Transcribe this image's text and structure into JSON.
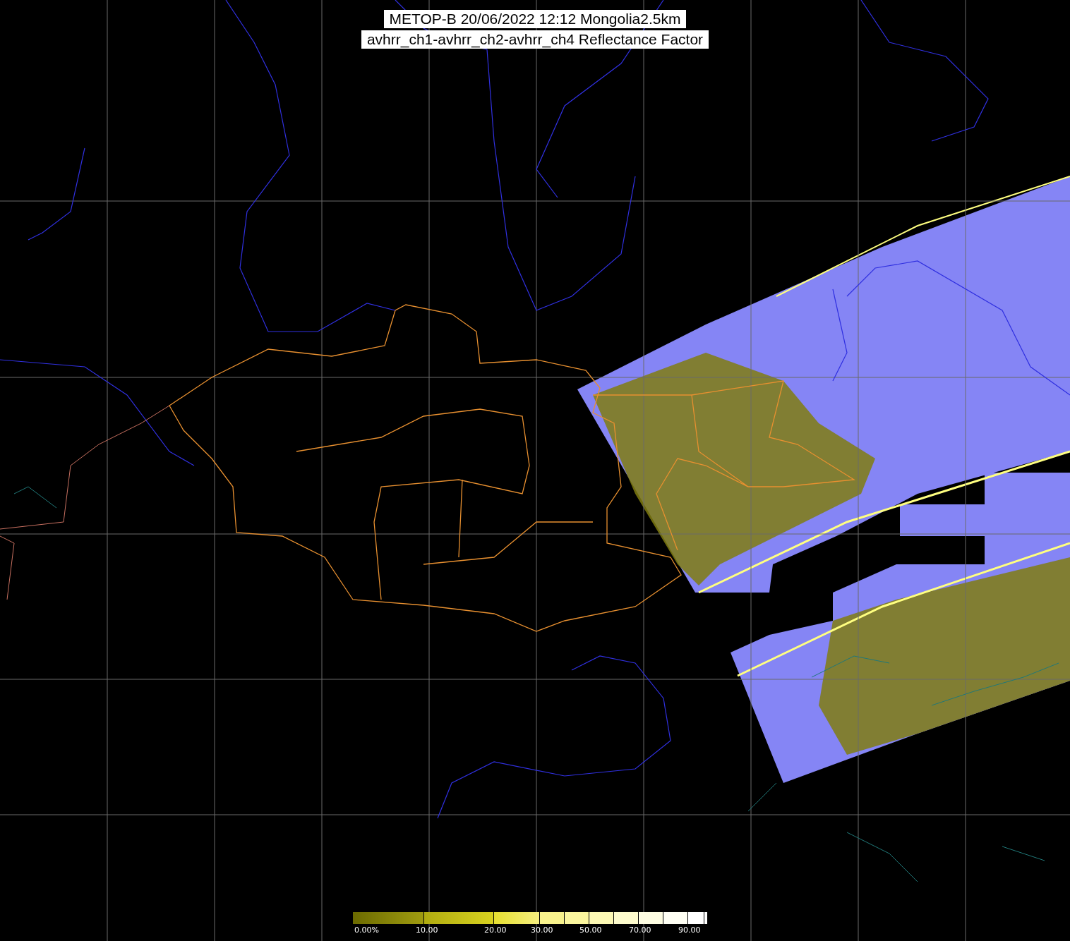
{
  "title": {
    "lines": [
      "METOP-B 20/06/2022 12:12 Mongolia2.5km",
      "avhrr_ch1-avhrr_ch2-avhrr_ch4 Reflectance Factor"
    ]
  },
  "color_scale": {
    "labels": [
      "0.00%",
      "10.00",
      "20.00",
      "30.00",
      "50.00",
      "70.00",
      "90.00"
    ]
  }
}
